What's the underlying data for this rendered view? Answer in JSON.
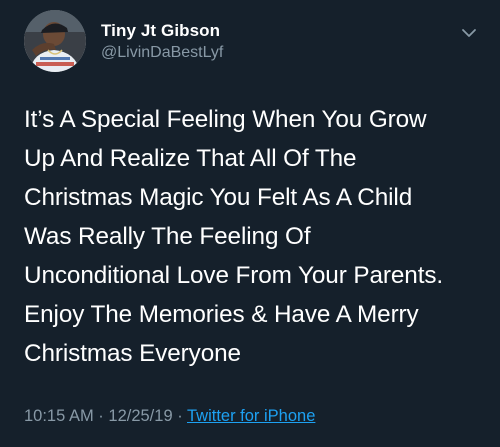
{
  "author": {
    "display_name": "Tiny Jt Gibson",
    "handle": "@LivinDaBestLyf"
  },
  "tweet": {
    "lines": [
      "It’s A Special Feeling When You Grow",
      "Up And Realize That All Of The",
      "Christmas Magic You Felt As A Child",
      "Was Really The Feeling Of",
      "Unconditional Love From Your Parents.",
      "Enjoy The Memories & Have A Merry",
      "Christmas Everyone"
    ],
    "time": "10:15 AM",
    "separator1": " · ",
    "date": "12/25/19",
    "separator2": " · ",
    "source": "Twitter for iPhone"
  },
  "icons": {
    "menu": "chevron-down-icon",
    "avatar": "avatar"
  },
  "colors": {
    "background": "#15202b",
    "text": "#ffffff",
    "secondary_text": "#8899a6",
    "link": "#1da1f2"
  }
}
